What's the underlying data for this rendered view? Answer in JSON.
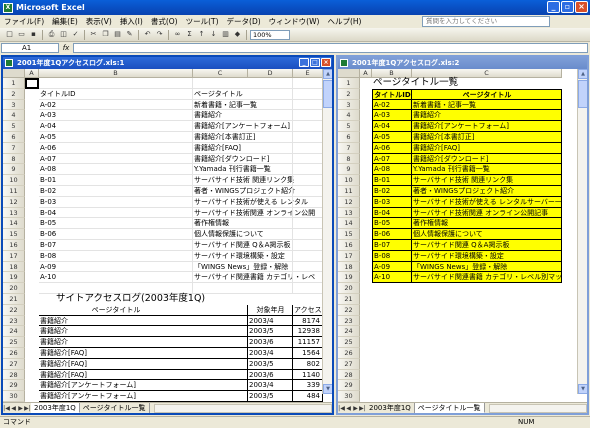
{
  "app": {
    "title": "Microsoft Excel"
  },
  "menu": [
    "ファイル(F)",
    "編集(E)",
    "表示(V)",
    "挿入(I)",
    "書式(O)",
    "ツール(T)",
    "データ(D)",
    "ウィンドウ(W)",
    "ヘルプ(H)"
  ],
  "help_placeholder": "質問を入力してください",
  "toolbar": {
    "zoom": "100%"
  },
  "formula": {
    "namebox": "A1",
    "fx": "fx",
    "value": ""
  },
  "left": {
    "title": "2001年度1Qアクセスログ.xls:1",
    "cols": [
      "A",
      "B",
      "C",
      "D",
      "E"
    ],
    "rows": [
      {
        "n": "1",
        "b": "",
        "c": "",
        "d": "",
        "e": ""
      },
      {
        "n": "2",
        "b": "タイトルID",
        "c": "ページタイトル",
        "d": "",
        "e": ""
      },
      {
        "n": "3",
        "b": "A-02",
        "c": "新着書籍・記事一覧",
        "d": "",
        "e": ""
      },
      {
        "n": "4",
        "b": "A-03",
        "c": "書籍紹介",
        "d": "",
        "e": ""
      },
      {
        "n": "5",
        "b": "A-04",
        "c": "書籍紹介[アンケートフォーム]",
        "d": "",
        "e": ""
      },
      {
        "n": "6",
        "b": "A-05",
        "c": "書籍紹介[本書訂正]",
        "d": "",
        "e": ""
      },
      {
        "n": "7",
        "b": "A-06",
        "c": "書籍紹介[FAQ]",
        "d": "",
        "e": ""
      },
      {
        "n": "8",
        "b": "A-07",
        "c": "書籍紹介[ダウンロード]",
        "d": "",
        "e": ""
      },
      {
        "n": "9",
        "b": "A-08",
        "c": "Y.Yamada 刊行書籍一覧",
        "d": "",
        "e": ""
      },
      {
        "n": "10",
        "b": "B-01",
        "c": "サーバサイド技術 関連リンク集",
        "d": "",
        "e": ""
      },
      {
        "n": "11",
        "b": "B-02",
        "c": "著者・WINGSプロジェクト紹介",
        "d": "",
        "e": ""
      },
      {
        "n": "12",
        "b": "B-03",
        "c": "サーバサイド技術が使える レンタル",
        "d": "",
        "e": ""
      },
      {
        "n": "13",
        "b": "B-04",
        "c": "サーバサイド技術関連 オンライン公開",
        "d": "",
        "e": ""
      },
      {
        "n": "14",
        "b": "B-05",
        "c": "著作権情報",
        "d": "",
        "e": ""
      },
      {
        "n": "15",
        "b": "B-06",
        "c": "個人情報保護について",
        "d": "",
        "e": ""
      },
      {
        "n": "16",
        "b": "B-07",
        "c": "サーバサイド関連 Q＆A掲示板",
        "d": "",
        "e": ""
      },
      {
        "n": "17",
        "b": "B-08",
        "c": "サーバサイド環境構築・設定",
        "d": "",
        "e": ""
      },
      {
        "n": "18",
        "b": "A-09",
        "c": "「WINGS News」登録・解除",
        "d": "",
        "e": ""
      },
      {
        "n": "19",
        "b": "A-10",
        "c": "サーバサイド関連書籍 カテゴリ・レベ",
        "d": "",
        "e": ""
      },
      {
        "n": "20",
        "b": "",
        "c": "",
        "d": "",
        "e": ""
      },
      {
        "n": "21",
        "b": "",
        "c": "",
        "d": "",
        "e": ""
      },
      {
        "n": "22",
        "b": "ページタイトル",
        "c": "",
        "d": "対象年月",
        "e": "アクセス数"
      },
      {
        "n": "23",
        "b": "書籍紹介",
        "c": "",
        "d": "2003/4",
        "e": "8174"
      },
      {
        "n": "24",
        "b": "書籍紹介",
        "c": "",
        "d": "2003/5",
        "e": "12938"
      },
      {
        "n": "25",
        "b": "書籍紹介",
        "c": "",
        "d": "2003/6",
        "e": "11157"
      },
      {
        "n": "26",
        "b": "書籍紹介[FAQ]",
        "c": "",
        "d": "2003/4",
        "e": "1564"
      },
      {
        "n": "27",
        "b": "書籍紹介[FAQ]",
        "c": "",
        "d": "2003/5",
        "e": "802"
      },
      {
        "n": "28",
        "b": "書籍紹介[FAQ]",
        "c": "",
        "d": "2003/6",
        "e": "1140"
      },
      {
        "n": "29",
        "b": "書籍紹介[アンケートフォーム]",
        "c": "",
        "d": "2003/4",
        "e": "339"
      },
      {
        "n": "30",
        "b": "書籍紹介[アンケートフォーム]",
        "c": "",
        "d": "2003/5",
        "e": "484"
      }
    ],
    "heading21": "サイトアクセスログ(2003年度1Q)",
    "tabs": [
      "2003年度1Q",
      "ページタイトル一覧"
    ]
  },
  "right": {
    "title": "2001年度1Qアクセスログ.xls:2",
    "cols": [
      "A",
      "B",
      "C"
    ],
    "heading": "ページタイトル一覧",
    "header": {
      "id": "タイトルID",
      "title": "ページタイトル"
    },
    "rows": [
      {
        "n": "3",
        "id": "A-02",
        "title": "新着書籍・記事一覧"
      },
      {
        "n": "4",
        "id": "A-03",
        "title": "書籍紹介"
      },
      {
        "n": "5",
        "id": "A-04",
        "title": "書籍紹介[アンケートフォーム]"
      },
      {
        "n": "6",
        "id": "A-05",
        "title": "書籍紹介[本書訂正]"
      },
      {
        "n": "7",
        "id": "A-06",
        "title": "書籍紹介[FAQ]"
      },
      {
        "n": "8",
        "id": "A-07",
        "title": "書籍紹介[ダウンロード]"
      },
      {
        "n": "9",
        "id": "A-08",
        "title": "Y.Yamada 刊行書籍一覧"
      },
      {
        "n": "10",
        "id": "B-01",
        "title": "サーバサイド技術 関連リンク集"
      },
      {
        "n": "11",
        "id": "B-02",
        "title": "著者・WINGSプロジェクト紹介"
      },
      {
        "n": "12",
        "id": "B-03",
        "title": "サーバサイド技術が使える レンタルサーバー一覧"
      },
      {
        "n": "13",
        "id": "B-04",
        "title": "サーバサイド技術関連 オンライン公開記事"
      },
      {
        "n": "14",
        "id": "B-05",
        "title": "著作権情報"
      },
      {
        "n": "15",
        "id": "B-06",
        "title": "個人情報保護について"
      },
      {
        "n": "16",
        "id": "B-07",
        "title": "サーバサイド関連 Q＆A掲示板"
      },
      {
        "n": "17",
        "id": "B-08",
        "title": "サーバサイド環境構築・設定"
      },
      {
        "n": "18",
        "id": "A-09",
        "title": "「WINGS News」登録・解除"
      },
      {
        "n": "19",
        "id": "A-10",
        "title": "サーバサイド関連書籍 カテゴリ・レベル別マップ"
      }
    ],
    "extra_rows": [
      "20",
      "21",
      "22",
      "23",
      "24",
      "25",
      "26",
      "27",
      "28",
      "29",
      "30",
      "31",
      "32",
      "33",
      "34"
    ],
    "tabs": [
      "2003年度1Q",
      "ページタイトル一覧"
    ]
  },
  "status": {
    "left": "コマンド",
    "num": "NUM"
  },
  "colors": {
    "highlight": "#ffff00",
    "titlebar": "#0a4ab8"
  }
}
